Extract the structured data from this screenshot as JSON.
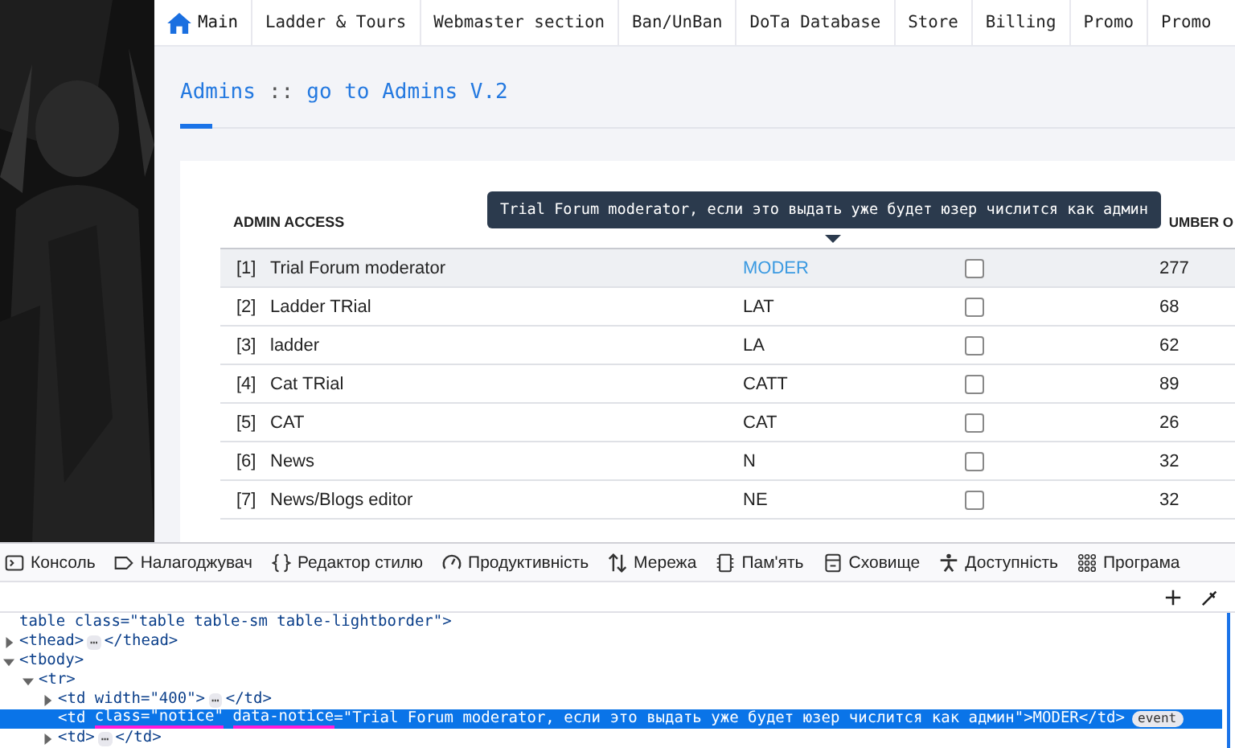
{
  "nav": [
    {
      "label": "Main",
      "selected": true
    },
    {
      "label": "Ladder & Tours",
      "selected": false
    },
    {
      "label": "Webmaster section",
      "selected": false
    },
    {
      "label": "Ban/UnBan",
      "selected": false
    },
    {
      "label": "DoTa Database",
      "selected": false
    },
    {
      "label": "Store",
      "selected": false
    },
    {
      "label": "Billing",
      "selected": false
    },
    {
      "label": "Promo",
      "selected": false
    },
    {
      "label": "Promo",
      "selected": false
    }
  ],
  "heading": {
    "title": "Admins",
    "separator": "::",
    "link": "go to Admins V.2"
  },
  "table": {
    "columns": [
      "ADMIN ACCESS",
      "UMBER O"
    ],
    "tooltip": "Trial Forum moderator, если это выдать уже будет юзер числится как админ",
    "rows": [
      {
        "index": "[1]",
        "name": "Trial Forum moderator",
        "code": "MODER",
        "checked": false,
        "count": "277",
        "selected": true
      },
      {
        "index": "[2]",
        "name": "Ladder TRial",
        "code": "LAT",
        "checked": false,
        "count": "68",
        "selected": false
      },
      {
        "index": "[3]",
        "name": "ladder",
        "code": "LA",
        "checked": false,
        "count": "62",
        "selected": false
      },
      {
        "index": "[4]",
        "name": "Cat TRial",
        "code": "CATT",
        "checked": false,
        "count": "89",
        "selected": false
      },
      {
        "index": "[5]",
        "name": "CAT",
        "code": "CAT",
        "checked": false,
        "count": "26",
        "selected": false
      },
      {
        "index": "[6]",
        "name": "News",
        "code": "N",
        "checked": false,
        "count": "32",
        "selected": false
      },
      {
        "index": "[7]",
        "name": "News/Blogs editor",
        "code": "NE",
        "checked": false,
        "count": "32",
        "selected": false
      }
    ]
  },
  "devtools": {
    "tabs": [
      "Консоль",
      "Налагоджувач",
      "Редактор стилю",
      "Продуктивність",
      "Мережа",
      "Пам'ять",
      "Сховище",
      "Доступність",
      "Програма"
    ],
    "nodes": [
      {
        "text": "table class=\"table table-sm table-lightborder\">",
        "selected": false
      },
      {
        "text": "<thead>",
        "expanded": false,
        "folded": "⋯",
        "close": "</thead>",
        "selected": false
      },
      {
        "text": "<tbody>",
        "expanded": true,
        "selected": false,
        "children": [
          {
            "text": "<tr>",
            "expanded": true,
            "selected": false,
            "children": [
              {
                "text": "<td width=\"400\">",
                "expanded": false,
                "folded": "⋯",
                "close": "</td>",
                "selected": false
              },
              {
                "parts": [
                  {
                    "text": "<td ",
                    "underlined": false
                  },
                  {
                    "text": "class=\"notice\"",
                    "underlined": true
                  },
                  {
                    "text": " data-notice",
                    "underlined": true
                  },
                  {
                    "text": "=\"Trial Forum moderator, если это выдать уже будет юзер числится как админ\">MODER</td>",
                    "underlined": false
                  }
                ],
                "selected": true,
                "badge": "event"
              },
              {
                "text": "<td>",
                "expanded": false,
                "folded": "⋯",
                "close": "</td>",
                "selected": false
              }
            ]
          }
        ]
      }
    ]
  }
}
